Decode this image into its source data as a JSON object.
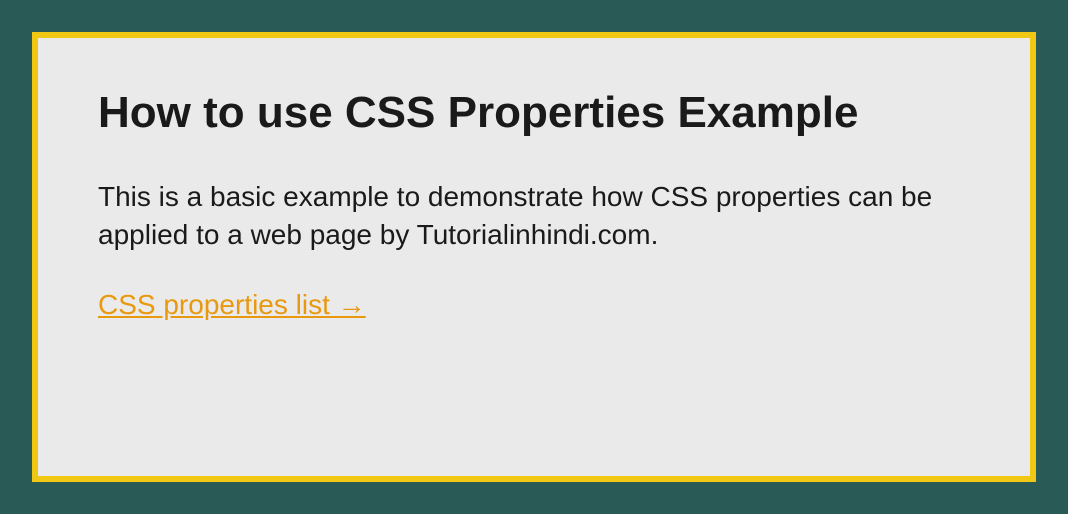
{
  "heading": "How to use CSS Properties Example",
  "paragraph": "This is a basic example to demonstrate how CSS properties can be applied to a web page by Tutorialinhindi.com.",
  "link_text": "CSS properties list →"
}
